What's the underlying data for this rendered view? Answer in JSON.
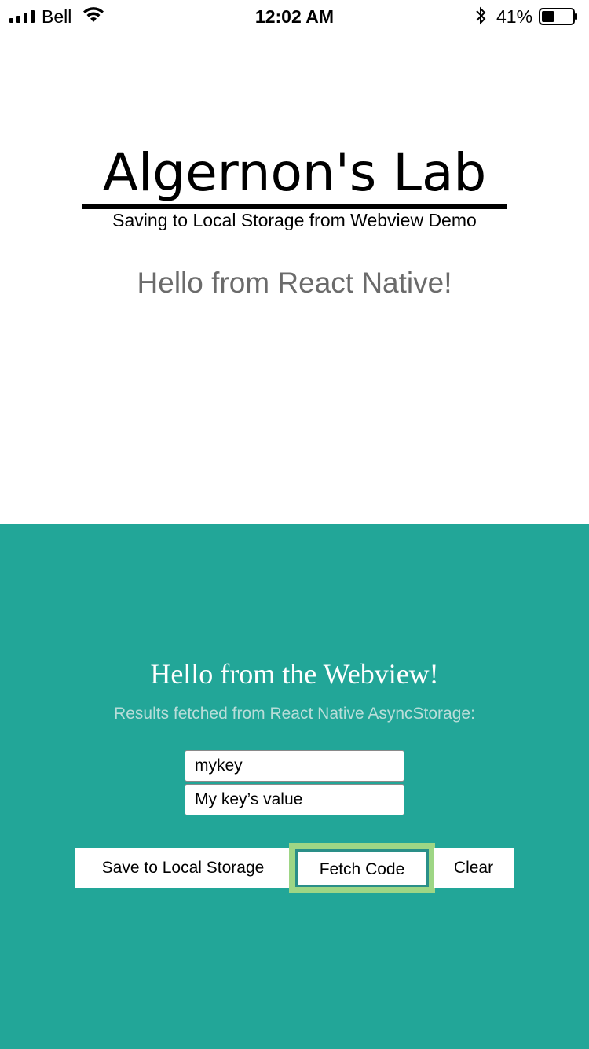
{
  "status_bar": {
    "carrier": "Bell",
    "time": "12:02 AM",
    "battery_percent": "41%",
    "battery_level": 0.41,
    "signal_bars": 4,
    "icons": [
      "signal-icon",
      "wifi-icon",
      "bluetooth-icon",
      "battery-icon"
    ]
  },
  "native": {
    "title": "Algernon's Lab",
    "subtitle": "Saving to Local Storage from Webview Demo",
    "hello": "Hello from React Native!"
  },
  "webview": {
    "hello": "Hello from the Webview!",
    "results_label": "Results fetched from React Native AsyncStorage:",
    "key_field_value": "mykey",
    "value_field_value": "My key’s value",
    "buttons": {
      "save": "Save to Local Storage",
      "fetch": "Fetch Code",
      "clear": "Clear"
    }
  },
  "colors": {
    "webview_background": "#22a698",
    "focus_ring": "#9ed685",
    "native_hello_text": "#6b6b6b"
  }
}
